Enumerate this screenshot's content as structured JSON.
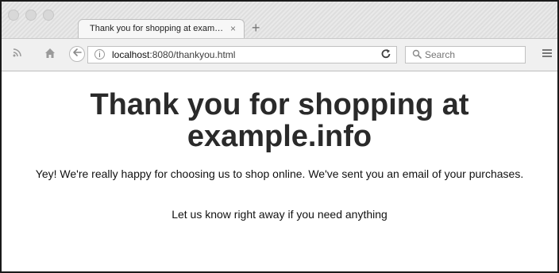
{
  "browser": {
    "tab": {
      "title": "Thank you for shopping at exam…",
      "close": "×"
    },
    "new_tab": "+",
    "url": {
      "host": "localhost",
      "path": ":8080/thankyou.html"
    },
    "search": {
      "placeholder": "Search"
    },
    "icons": {
      "rss": "rss-icon",
      "home": "home-icon",
      "back": "back-arrow-icon",
      "info": "info-icon",
      "reload": "reload-icon",
      "search": "search-icon",
      "menu": "hamburger-menu-icon"
    }
  },
  "page": {
    "heading": "Thank you for shopping at example.info",
    "message1": "Yey! We're really happy for choosing us to shop online. We've sent you an email of your purchases.",
    "message2": "Let us know right away if you need anything"
  }
}
